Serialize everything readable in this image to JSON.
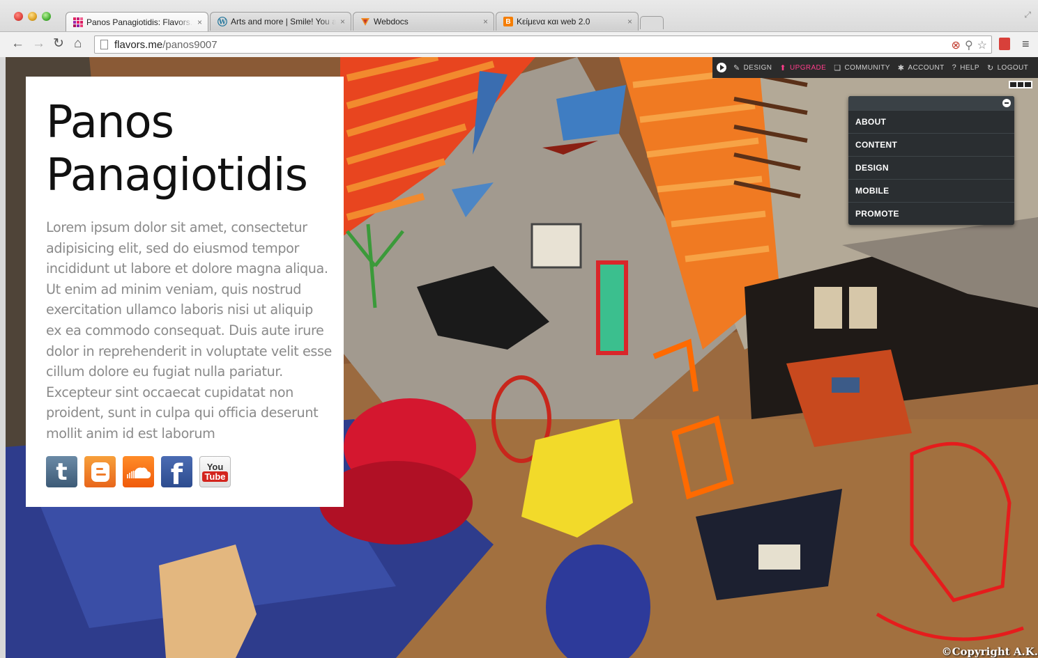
{
  "browser": {
    "tabs": [
      {
        "title": "Panos Panagiotidis: Flavors.me",
        "favicon": "flavors-grid-icon",
        "active": true
      },
      {
        "title": "Arts and more | Smile! You are beautiful",
        "favicon": "wordpress-icon",
        "active": false
      },
      {
        "title": "Webdocs",
        "favicon": "webdocs-icon",
        "active": false
      },
      {
        "title": "Κείμενα και web 2.0",
        "favicon": "blogger-icon",
        "active": false
      }
    ],
    "close_glyph": "×",
    "url_domain": "flavors.me",
    "url_path": "/panos9007"
  },
  "adminbar": {
    "items": [
      {
        "label": "DESIGN",
        "icon": "pencil-icon"
      },
      {
        "label": "UPGRADE",
        "icon": "up-arrow-icon"
      },
      {
        "label": "COMMUNITY",
        "icon": "book-icon"
      },
      {
        "label": "ACCOUNT",
        "icon": "gear-icon"
      },
      {
        "label": "HELP",
        "icon": "question-icon"
      },
      {
        "label": "LOGOUT",
        "icon": "logout-icon"
      }
    ],
    "upgrade_color": "#ff3d8b"
  },
  "panel": {
    "items": [
      "ABOUT",
      "CONTENT",
      "DESIGN",
      "MOBILE",
      "PROMOTE"
    ]
  },
  "profile": {
    "name": "Panos Panagiotidis",
    "bio": "Lorem ipsum dolor sit amet, consectetur adipisicing elit, sed do eiusmod tempor incididunt ut labore et dolore magna aliqua. Ut enim ad minim veniam, quis nostrud exercitation ullamco laboris nisi ut aliquip ex ea commodo consequat. Duis aute irure dolor in reprehenderit in voluptate velit esse cillum dolore eu fugiat nulla pariatur. Excepteur sint occaecat cupidatat non proident, sunt in culpa qui officia deserunt mollit anim id est laborum",
    "socials": [
      {
        "name": "tumblr",
        "glyph": "t"
      },
      {
        "name": "blogger",
        "glyph": ""
      },
      {
        "name": "soundcloud",
        "glyph": ""
      },
      {
        "name": "facebook",
        "glyph": "f"
      },
      {
        "name": "youtube",
        "you": "You",
        "tube": "Tube"
      }
    ]
  },
  "copyright": "©Copyright A.K."
}
